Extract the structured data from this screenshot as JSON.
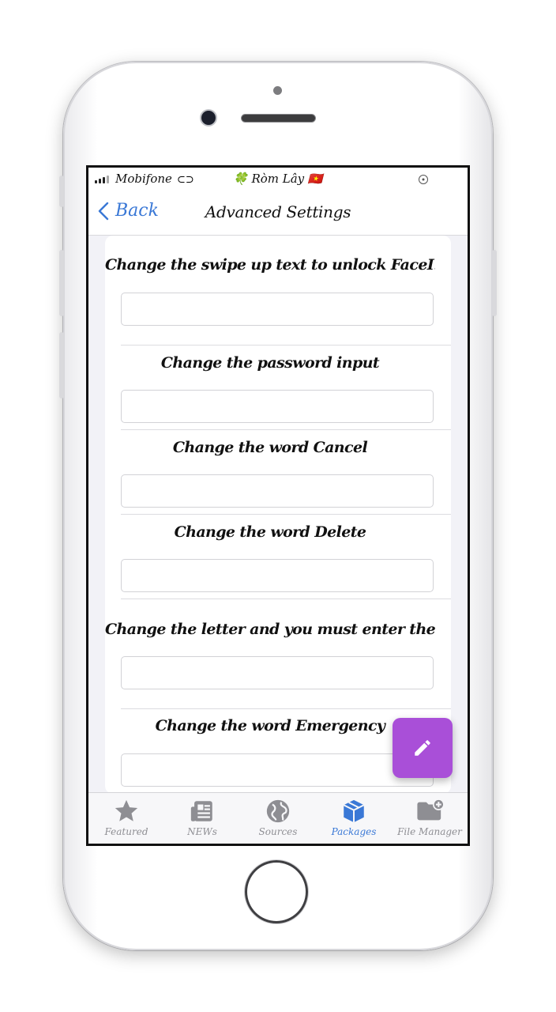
{
  "status_bar": {
    "carrier": "Mobifone",
    "center_text": "🍀 Ròm Lây 🇻🇳"
  },
  "nav": {
    "back_label": "Back",
    "title": "Advanced Settings"
  },
  "settings": [
    {
      "label": "Change the swipe up text to unlock FaceI...",
      "value": ""
    },
    {
      "label": "Change the password input",
      "value": ""
    },
    {
      "label": "Change the word Cancel",
      "value": ""
    },
    {
      "label": "Change the word Delete",
      "value": ""
    },
    {
      "label": "Change the letter and you must enter the pa...",
      "value": ""
    },
    {
      "label": "Change the word Emergency",
      "value": ""
    }
  ],
  "fab": {
    "icon": "pencil-icon",
    "color": "#a94fd8"
  },
  "tabbar": {
    "active": "Packages",
    "tabs": [
      {
        "label": "Featured",
        "icon": "star-icon"
      },
      {
        "label": "NEWs",
        "icon": "news-icon"
      },
      {
        "label": "Sources",
        "icon": "globe-icon"
      },
      {
        "label": "Packages",
        "icon": "box-icon"
      },
      {
        "label": "File Manager",
        "icon": "folder-add-icon"
      }
    ]
  },
  "colors": {
    "accent": "#3a78d6",
    "inactive": "#8e8e93"
  }
}
